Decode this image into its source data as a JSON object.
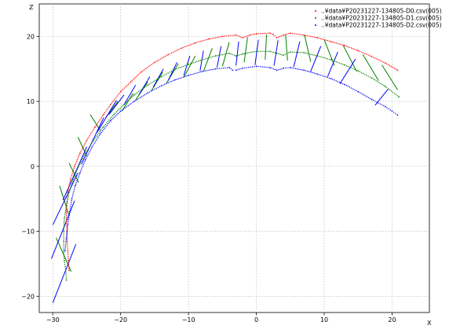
{
  "chart_data": {
    "type": "scatter",
    "title": "",
    "xlabel": "X",
    "ylabel": "Z",
    "xlim": [
      -32,
      25.5
    ],
    "ylim": [
      -22.5,
      25
    ],
    "xticks": [
      -30,
      -20,
      -10,
      0,
      10,
      20
    ],
    "yticks": [
      -20,
      -10,
      0,
      10,
      20
    ],
    "xtick_labels": [
      "−30",
      "−20",
      "−10",
      "0",
      "10",
      "20"
    ],
    "ytick_labels": [
      "−20",
      "−10",
      "0",
      "10",
      "20"
    ],
    "grid": true,
    "legend_position": "top-right",
    "series": [
      {
        "name": "..¥data¥P20231227-134805-D0.csv(005)",
        "color": "#ff0000",
        "points": [
          [
            -27.6,
            -16.0
          ],
          [
            -27.7,
            -14.5
          ],
          [
            -27.8,
            -13.0
          ],
          [
            -27.9,
            -11.5
          ],
          [
            -27.9,
            -10.0
          ],
          [
            -28.0,
            -8.5
          ],
          [
            -28.0,
            -7.0
          ],
          [
            -27.9,
            -5.5
          ],
          [
            -27.8,
            -4.0
          ],
          [
            -27.4,
            -2.0
          ],
          [
            -26.8,
            0.0
          ],
          [
            -26.0,
            2.0
          ],
          [
            -25.0,
            4.0
          ],
          [
            -23.8,
            6.0
          ],
          [
            -22.5,
            8.0
          ],
          [
            -21.5,
            9.5
          ],
          [
            -20.0,
            11.5
          ],
          [
            -18.5,
            13.0
          ],
          [
            -17.0,
            14.5
          ],
          [
            -15.0,
            16.0
          ],
          [
            -13.0,
            17.2
          ],
          [
            -11.0,
            18.2
          ],
          [
            -9.0,
            19.0
          ],
          [
            -7.0,
            19.6
          ],
          [
            -5.0,
            20.0
          ],
          [
            -3.0,
            20.2
          ],
          [
            -2.0,
            19.8
          ],
          [
            -1.0,
            20.2
          ],
          [
            0.0,
            20.4
          ],
          [
            2.0,
            20.5
          ],
          [
            2.5,
            20.3
          ],
          [
            3.0,
            19.8
          ],
          [
            4.0,
            20.2
          ],
          [
            5.0,
            20.5
          ],
          [
            7.0,
            20.2
          ],
          [
            9.0,
            19.8
          ],
          [
            11.0,
            19.2
          ],
          [
            13.0,
            18.6
          ],
          [
            15.0,
            17.8
          ],
          [
            17.0,
            16.9
          ],
          [
            19.0,
            15.9
          ],
          [
            20.8,
            14.8
          ]
        ]
      },
      {
        "name": "..¥data¥P20231227-134805-D1.csv(005)",
        "color": "#008000",
        "points": [
          [
            -28.0,
            -17.5
          ],
          [
            -28.1,
            -16.0
          ],
          [
            -28.3,
            -14.5
          ],
          [
            -28.4,
            -13.0
          ],
          [
            -28.4,
            -11.5
          ],
          [
            -28.4,
            -10.0
          ],
          [
            -28.3,
            -8.0
          ],
          [
            -28.0,
            -6.0
          ],
          [
            -27.6,
            -4.0
          ],
          [
            -27.0,
            -2.0
          ],
          [
            -26.2,
            0.0
          ],
          [
            -25.2,
            2.0
          ],
          [
            -24.0,
            4.0
          ],
          [
            -22.6,
            6.0
          ],
          [
            -21.0,
            8.0
          ],
          [
            -19.5,
            9.5
          ],
          [
            -18.0,
            11.0
          ],
          [
            -16.0,
            12.5
          ],
          [
            -14.0,
            13.8
          ],
          [
            -12.0,
            14.9
          ],
          [
            -10.0,
            15.7
          ],
          [
            -8.0,
            16.4
          ],
          [
            -6.0,
            17.0
          ],
          [
            -4.0,
            17.4
          ],
          [
            -3.0,
            17.0
          ],
          [
            -2.0,
            17.3
          ],
          [
            0.0,
            17.7
          ],
          [
            2.0,
            17.7
          ],
          [
            3.0,
            17.4
          ],
          [
            4.0,
            17.1
          ],
          [
            5.0,
            17.6
          ],
          [
            7.0,
            17.5
          ],
          [
            9.0,
            17.0
          ],
          [
            11.0,
            16.4
          ],
          [
            13.0,
            15.6
          ],
          [
            15.0,
            14.7
          ],
          [
            17.0,
            13.6
          ],
          [
            19.0,
            12.3
          ],
          [
            21.0,
            10.7
          ]
        ]
      },
      {
        "name": "..¥data¥P20231227-134805-D2.csv(005)",
        "color": "#0000ff",
        "points": [
          [
            -28.2,
            -13.0
          ],
          [
            -28.0,
            -11.0
          ],
          [
            -27.8,
            -9.0
          ],
          [
            -27.5,
            -7.0
          ],
          [
            -27.2,
            -5.0
          ],
          [
            -26.7,
            -3.0
          ],
          [
            -26.0,
            -1.0
          ],
          [
            -25.2,
            1.0
          ],
          [
            -24.2,
            3.0
          ],
          [
            -23.0,
            5.0
          ],
          [
            -21.5,
            7.0
          ],
          [
            -20.0,
            8.5
          ],
          [
            -18.0,
            10.0
          ],
          [
            -16.0,
            11.3
          ],
          [
            -14.0,
            12.4
          ],
          [
            -12.0,
            13.3
          ],
          [
            -10.0,
            14.0
          ],
          [
            -8.0,
            14.6
          ],
          [
            -6.0,
            15.0
          ],
          [
            -4.0,
            15.2
          ],
          [
            -3.5,
            14.8
          ],
          [
            -3.0,
            14.8
          ],
          [
            -2.0,
            15.1
          ],
          [
            0.0,
            15.4
          ],
          [
            2.0,
            15.2
          ],
          [
            3.0,
            14.8
          ],
          [
            4.0,
            15.1
          ],
          [
            5.0,
            15.2
          ],
          [
            7.0,
            14.8
          ],
          [
            9.0,
            14.2
          ],
          [
            11.0,
            13.5
          ],
          [
            13.0,
            12.6
          ],
          [
            15.0,
            11.5
          ],
          [
            17.0,
            10.3
          ],
          [
            19.0,
            9.2
          ],
          [
            20.0,
            8.5
          ],
          [
            20.8,
            7.9
          ]
        ]
      }
    ],
    "segments": [
      {
        "color": "#008000",
        "lines": [
          [
            [
              -27.3,
              -16.2
            ],
            [
              -29.5,
              -11.0
            ]
          ],
          [
            [
              -27.6,
              -7.6
            ],
            [
              -29.0,
              -3.0
            ]
          ],
          [
            [
              -26.2,
              -2.5
            ],
            [
              -27.6,
              0.5
            ]
          ],
          [
            [
              -25.0,
              1.6
            ],
            [
              -26.3,
              4.5
            ]
          ],
          [
            [
              -23.0,
              5.5
            ],
            [
              -24.5,
              8.0
            ]
          ],
          [
            [
              -20.4,
              10.0
            ],
            [
              -22.2,
              7.5
            ]
          ],
          [
            [
              -18.2,
              11.2
            ],
            [
              -19.8,
              8.5
            ]
          ],
          [
            [
              -16.0,
              13.0
            ],
            [
              -17.8,
              10.2
            ]
          ],
          [
            [
              -13.8,
              14.5
            ],
            [
              -15.5,
              11.6
            ]
          ],
          [
            [
              -11.5,
              15.8
            ],
            [
              -13.3,
              12.7
            ]
          ],
          [
            [
              -9.0,
              17.0
            ],
            [
              -10.7,
              13.7
            ]
          ],
          [
            [
              -6.5,
              18.2
            ],
            [
              -7.8,
              14.6
            ]
          ],
          [
            [
              -4.0,
              19.1
            ],
            [
              -5.0,
              15.4
            ]
          ],
          [
            [
              -1.3,
              19.9
            ],
            [
              -1.8,
              16.0
            ]
          ],
          [
            [
              1.5,
              20.3
            ],
            [
              1.3,
              16.4
            ]
          ],
          [
            [
              4.3,
              20.3
            ],
            [
              4.6,
              16.3
            ]
          ],
          [
            [
              7.1,
              20.2
            ],
            [
              8.0,
              16.1
            ]
          ],
          [
            [
              10.0,
              19.5
            ],
            [
              11.5,
              15.5
            ]
          ],
          [
            [
              12.8,
              18.6
            ],
            [
              14.8,
              14.6
            ]
          ],
          [
            [
              15.7,
              17.2
            ],
            [
              18.0,
              13.2
            ]
          ],
          [
            [
              18.5,
              15.6
            ],
            [
              20.8,
              11.8
            ]
          ]
        ]
      },
      {
        "color": "#0000ff",
        "lines": [
          [
            [
              -30.0,
              -21.0
            ],
            [
              -26.6,
              -12.0
            ]
          ],
          [
            [
              -30.2,
              -14.2
            ],
            [
              -26.8,
              -5.3
            ]
          ],
          [
            [
              -30.0,
              -9.0
            ],
            [
              -26.3,
              -1.0
            ]
          ],
          [
            [
              -28.5,
              -5.2
            ],
            [
              -25.0,
              3.0
            ]
          ],
          [
            [
              -25.8,
              0.3
            ],
            [
              -22.5,
              7.5
            ]
          ],
          [
            [
              -23.5,
              5.2
            ],
            [
              -20.6,
              10.2
            ]
          ],
          [
            [
              -21.7,
              8.0
            ],
            [
              -19.5,
              11.0
            ]
          ],
          [
            [
              -19.5,
              9.5
            ],
            [
              -17.8,
              12.5
            ]
          ],
          [
            [
              -17.3,
              11.0
            ],
            [
              -15.7,
              13.8
            ]
          ],
          [
            [
              -15.2,
              12.2
            ],
            [
              -13.7,
              15.0
            ]
          ],
          [
            [
              -13.0,
              13.2
            ],
            [
              -11.7,
              16.0
            ]
          ],
          [
            [
              -10.7,
              14.0
            ],
            [
              -9.8,
              17.0
            ]
          ],
          [
            [
              -8.3,
              14.7
            ],
            [
              -7.8,
              17.8
            ]
          ],
          [
            [
              -5.8,
              15.2
            ],
            [
              -5.2,
              18.5
            ]
          ],
          [
            [
              -3.0,
              15.5
            ],
            [
              -2.6,
              19.2
            ]
          ],
          [
            [
              -0.2,
              15.6
            ],
            [
              0.3,
              19.5
            ]
          ],
          [
            [
              2.6,
              15.5
            ],
            [
              3.2,
              19.4
            ]
          ],
          [
            [
              5.5,
              15.3
            ],
            [
              6.4,
              19.2
            ]
          ],
          [
            [
              8.0,
              14.6
            ],
            [
              9.5,
              18.5
            ]
          ],
          [
            [
              10.5,
              13.8
            ],
            [
              12.0,
              17.6
            ]
          ],
          [
            [
              12.3,
              12.7
            ],
            [
              14.6,
              16.5
            ]
          ],
          [
            [
              17.5,
              9.4
            ],
            [
              19.5,
              12.0
            ]
          ]
        ]
      }
    ]
  }
}
